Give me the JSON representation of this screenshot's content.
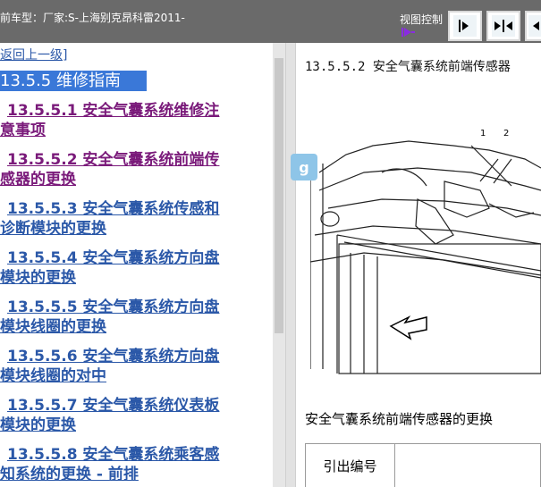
{
  "header": {
    "vehicle_label": "前车型：厂家:S-上海别克昂科雷2011-",
    "view_control_label": "视图控制",
    "buttons": [
      {
        "name": "show-right-pane-button",
        "icon": "arrow-right-icon"
      },
      {
        "name": "split-view-button",
        "icon": "split-arrows-icon"
      },
      {
        "name": "show-left-pane-button",
        "icon": "arrow-left-icon"
      }
    ]
  },
  "left": {
    "back_link": "返回上一级]",
    "section_title": "13.5.5 维修指南",
    "items": [
      {
        "line1": "13.5.5.1 安全气囊系统维修注",
        "line2": "意事项",
        "visited": true
      },
      {
        "line1": "13.5.5.2 安全气囊系统前端传",
        "line2": "感器的更换",
        "visited": true
      },
      {
        "line1": "13.5.5.3 安全气囊系统传感和",
        "line2": "诊断模块的更换",
        "visited": false
      },
      {
        "line1": "13.5.5.4 安全气囊系统方向盘",
        "line2": "模块的更换",
        "visited": false
      },
      {
        "line1": "13.5.5.5 安全气囊系统方向盘",
        "line2": "模块线圈的更换",
        "visited": false
      },
      {
        "line1": "13.5.5.6 安全气囊系统方向盘",
        "line2": "模块线圈的对中",
        "visited": false
      },
      {
        "line1": "13.5.5.7 安全气囊系统仪表板",
        "line2": "模块的更换",
        "visited": false
      },
      {
        "line1": "13.5.5.8 安全气囊系统乘客感",
        "line2": "知系统的更换 - 前排",
        "visited": false
      }
    ]
  },
  "right": {
    "heading": "13.5.5.2 安全气囊系统前端传感器",
    "diagram_callouts": [
      "1",
      "2"
    ],
    "caption": "安全气囊系统前端传感器的更换",
    "table_header": "引出编号"
  },
  "float_icon_glyph": "g",
  "colors": {
    "topbar": "#6a6a6a",
    "link": "#2b58a8",
    "visited_link": "#7a1a7a",
    "selection": "#3a78d8"
  }
}
